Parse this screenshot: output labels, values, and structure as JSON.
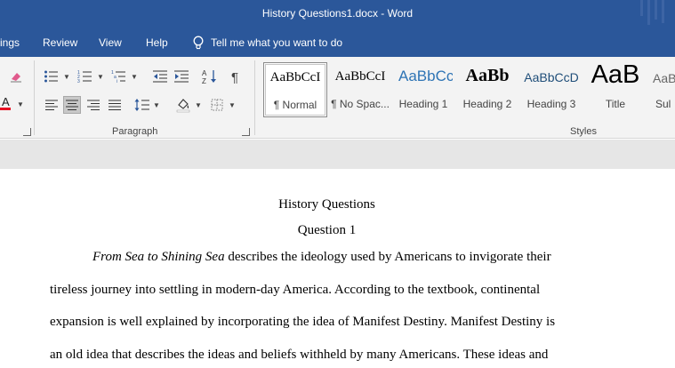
{
  "window": {
    "title": "History Questions1.docx  -  Word"
  },
  "ribbon_tabs": {
    "layout_partial": "ings",
    "review": "Review",
    "view": "View",
    "help": "Help",
    "tell_me": "Tell me what you want to do"
  },
  "paragraph_group": {
    "label": "Paragraph"
  },
  "styles_group": {
    "label": "Styles",
    "items": [
      {
        "preview": "AaBbCcI",
        "name": "¶ Normal"
      },
      {
        "preview": "AaBbCcI",
        "name": "¶ No Spac..."
      },
      {
        "preview": "AaBbCc",
        "name": "Heading 1"
      },
      {
        "preview": "AaBb",
        "name": "Heading 2"
      },
      {
        "preview": "AaBbCcD",
        "name": "Heading 3"
      },
      {
        "preview": "AaB",
        "name": "Title"
      },
      {
        "preview": "AaBb",
        "name": "Sul"
      }
    ]
  },
  "colors": {
    "word_blue": "#2b579a",
    "font_color_red": "#e81123",
    "heading_blue": "#2e74b5",
    "heading3_blue": "#1f4e79"
  },
  "document": {
    "title": "History Questions",
    "subtitle": "Question 1",
    "line1_italic": "From Sea to Shining Sea",
    "line1_rest": " describes the ideology used by Americans to invigorate their",
    "line2": "tireless journey into settling in modern-day America. According to the textbook, continental",
    "line3": "expansion is well explained by incorporating the idea of Manifest Destiny. Manifest Destiny is",
    "line4": "an old idea that describes the ideas and beliefs withheld by many Americans. These ideas and"
  }
}
